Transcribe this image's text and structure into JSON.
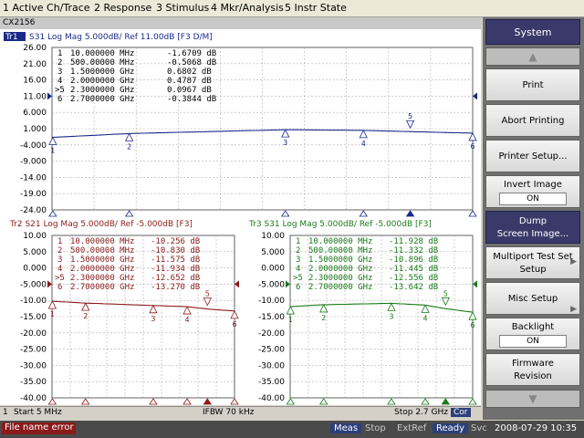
{
  "menu": [
    "1 Active Ch/Trace",
    "2 Response",
    "3 Stimulus",
    "4 Mkr/Analysis",
    "5 Instr State"
  ],
  "instrument_title": "CX2156",
  "colors": {
    "tr1": "#1a2a8a",
    "tr2": "#8b1a1a",
    "tr3": "#1a7a1a",
    "softkey_header": "#3a3a6a",
    "error": "#8b1a1a"
  },
  "chart_data": [
    {
      "type": "line",
      "header": "S31  Log Mag 5.000dB/ Ref 11.00dB [F3 D/M]",
      "trace_label": "Tr1",
      "y_ticks": [
        "26.00",
        "21.00",
        "16.00",
        "11.00",
        "6.000",
        "1.000",
        "-4.000",
        "-9.000",
        "-14.00",
        "-19.00",
        "-24.00"
      ],
      "ylim": [
        -24,
        26
      ],
      "ref": 11.0,
      "xlim_hz": [
        5000000,
        2700000000
      ],
      "markers": [
        {
          "n": "1",
          "freq": "10.000000 MHz",
          "val": "-1.6709 dB",
          "x": 10000000,
          "y": -1.6709
        },
        {
          "n": "2",
          "freq": "500.00000 MHz",
          "val": "-0.5068 dB",
          "x": 500000000,
          "y": -0.5068
        },
        {
          "n": "3",
          "freq": "1.5000000 GHz",
          "val": "0.6802 dB",
          "x": 1500000000,
          "y": 0.6802
        },
        {
          "n": "4",
          "freq": "2.0000000 GHz",
          "val": "0.4787 dB",
          "x": 2000000000,
          "y": 0.4787
        },
        {
          "n": ">5",
          "freq": "2.3000000 GHz",
          "val": "0.0967 dB",
          "x": 2300000000,
          "y": 0.0967
        },
        {
          "n": "6",
          "freq": "2.7000000 GHz",
          "val": "-0.3844 dB",
          "x": 2700000000,
          "y": -0.3844
        }
      ]
    },
    {
      "type": "line",
      "header": "Tr2 S21 Log Mag 5.000dB/ Ref -5.000dB [F3]",
      "y_ticks": [
        "10.00",
        "5.000",
        "0.000",
        "-5.000",
        "-10.00",
        "-15.00",
        "-20.00",
        "-25.00",
        "-30.00",
        "-35.00",
        "-40.00"
      ],
      "ylim": [
        -40,
        10
      ],
      "ref": -5.0,
      "xlim_hz": [
        5000000,
        2700000000
      ],
      "markers": [
        {
          "n": "1",
          "freq": "10.000000 MHz",
          "val": "-10.256 dB",
          "x": 10000000,
          "y": -10.256
        },
        {
          "n": "2",
          "freq": "500.00000 MHz",
          "val": "-10.830 dB",
          "x": 500000000,
          "y": -10.83
        },
        {
          "n": "3",
          "freq": "1.5000000 GHz",
          "val": "-11.575 dB",
          "x": 1500000000,
          "y": -11.575
        },
        {
          "n": "4",
          "freq": "2.0000000 GHz",
          "val": "-11.934 dB",
          "x": 2000000000,
          "y": -11.934
        },
        {
          "n": ">5",
          "freq": "2.3000000 GHz",
          "val": "-12.652 dB",
          "x": 2300000000,
          "y": -12.652
        },
        {
          "n": "6",
          "freq": "2.7000000 GHz",
          "val": "-13.270 dB",
          "x": 2700000000,
          "y": -13.27
        }
      ]
    },
    {
      "type": "line",
      "header": "Tr3 S31 Log Mag 5.000dB/ Ref -5.000dB [F3]",
      "y_ticks": [
        "10.00",
        "5.000",
        "0.000",
        "-5.000",
        "-10.00",
        "-15.00",
        "-20.00",
        "-25.00",
        "-30.00",
        "-35.00",
        "-40.00"
      ],
      "ylim": [
        -40,
        10
      ],
      "ref": -5.0,
      "xlim_hz": [
        5000000,
        2700000000
      ],
      "markers": [
        {
          "n": "1",
          "freq": "10.000000 MHz",
          "val": "-11.928 dB",
          "x": 10000000,
          "y": -11.928
        },
        {
          "n": "2",
          "freq": "500.00000 MHz",
          "val": "-11.332 dB",
          "x": 500000000,
          "y": -11.332
        },
        {
          "n": "3",
          "freq": "1.5000000 GHz",
          "val": "-10.896 dB",
          "x": 1500000000,
          "y": -10.896
        },
        {
          "n": "4",
          "freq": "2.0000000 GHz",
          "val": "-11.445 dB",
          "x": 2000000000,
          "y": -11.445
        },
        {
          "n": ">5",
          "freq": "2.3000000 GHz",
          "val": "-12.556 dB",
          "x": 2300000000,
          "y": -12.556
        },
        {
          "n": "6",
          "freq": "2.7000000 GHz",
          "val": "-13.642 dB",
          "x": 2700000000,
          "y": -13.642
        }
      ]
    }
  ],
  "status": {
    "channel": "1",
    "start": "Start 5 MHz",
    "ifbw": "IFBW 70 kHz",
    "stop": "Stop 2.7 GHz",
    "cor": "Cor"
  },
  "bottom": {
    "error": "File name error",
    "meas": "Meas",
    "stop": "Stop",
    "extref": "ExtRef",
    "ready": "Ready",
    "svc": "Svc",
    "datetime": "2008-07-29 10:35"
  },
  "softkeys": {
    "title": "System",
    "print": "Print",
    "abort": "Abort Printing",
    "printer_setup": "Printer Setup...",
    "invert_label": "Invert Image",
    "invert_value": "ON",
    "dump_line1": "Dump",
    "dump_line2": "Screen Image...",
    "multiport_line1": "Multiport Test Set",
    "multiport_line2": "Setup",
    "misc": "Misc Setup",
    "backlight_label": "Backlight",
    "backlight_value": "ON",
    "firmware_line1": "Firmware",
    "firmware_line2": "Revision"
  }
}
